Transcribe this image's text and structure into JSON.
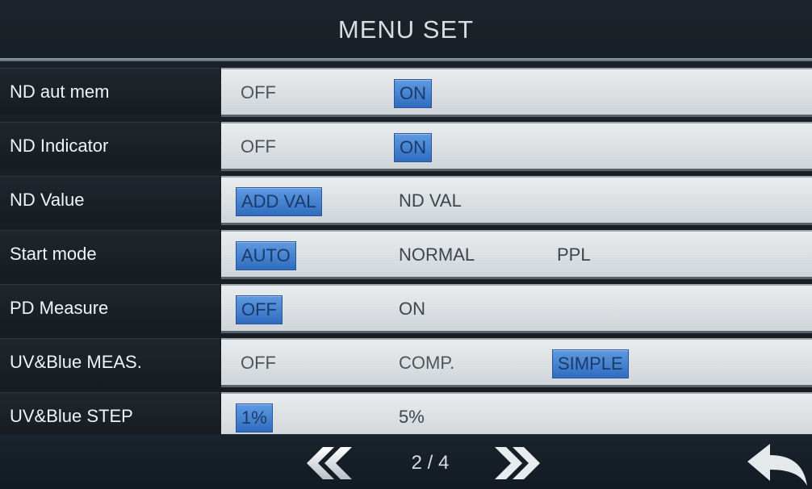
{
  "header": {
    "title": "MENU SET"
  },
  "rows": [
    {
      "label": "ND aut mem",
      "options": [
        "OFF",
        "ON"
      ]
    },
    {
      "label": "ND Indicator",
      "options": [
        "OFF",
        "ON"
      ]
    },
    {
      "label": "ND Value",
      "options": [
        "ADD VAL",
        "ND VAL"
      ]
    },
    {
      "label": "Start mode",
      "options": [
        "AUTO",
        "NORMAL",
        "PPL"
      ]
    },
    {
      "label": "PD Measure",
      "options": [
        "OFF",
        "ON"
      ]
    },
    {
      "label": "UV&Blue MEAS.",
      "options": [
        "OFF",
        "COMP.",
        "SIMPLE"
      ]
    },
    {
      "label": "UV&Blue STEP",
      "options": [
        "1%",
        "5%"
      ]
    }
  ],
  "selected": {
    "nd_aut_mem": "ON",
    "nd_indicator": "ON",
    "nd_value": "ADD VAL",
    "start_mode": "AUTO",
    "pd_measure": "OFF",
    "uv_blue_meas": "SIMPLE",
    "uv_blue_step": "1%"
  },
  "footer": {
    "page_indicator": "2 / 4",
    "prev_icon": "double-chevron-left-icon",
    "next_icon": "double-chevron-right-icon",
    "back_icon": "return-arrow-icon"
  },
  "colors": {
    "selected_bg": "#3f7fd0",
    "row_bg": "#dde1e4",
    "label_bg": "#1a2027"
  }
}
